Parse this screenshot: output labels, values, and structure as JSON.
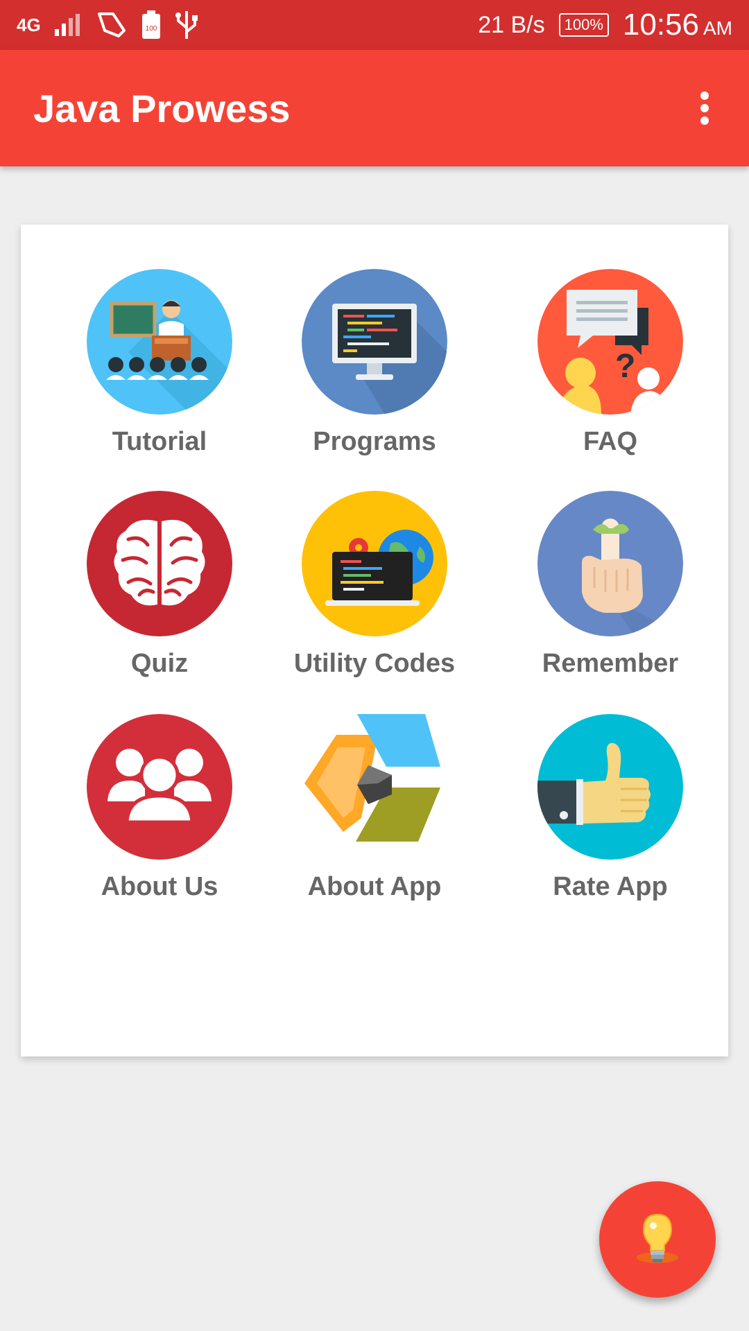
{
  "status_bar": {
    "network": "4G",
    "speed": "21 B/s",
    "battery": "100%",
    "battery_small": "100",
    "time": "10:56",
    "ampm": "AM"
  },
  "app_bar": {
    "title": "Java Prowess",
    "menu_icon": "more-vertical-icon"
  },
  "menu": {
    "items": [
      {
        "label": "Tutorial",
        "icon": "classroom-icon"
      },
      {
        "label": "Programs",
        "icon": "monitor-code-icon"
      },
      {
        "label": "FAQ",
        "icon": "faq-chat-icon"
      },
      {
        "label": "Quiz",
        "icon": "brain-icon"
      },
      {
        "label": "Utility Codes",
        "icon": "laptop-globe-icon"
      },
      {
        "label": "Remember",
        "icon": "finger-ribbon-icon"
      },
      {
        "label": "About Us",
        "icon": "people-group-icon"
      },
      {
        "label": "About App",
        "icon": "app-logo-icon"
      },
      {
        "label": "Rate App",
        "icon": "thumbs-up-icon"
      }
    ]
  },
  "fab": {
    "icon": "lightbulb-icon"
  },
  "colors": {
    "status_bar": "#d32f2f",
    "app_bar": "#f44336",
    "background": "#eeeeee",
    "label": "#666666"
  }
}
